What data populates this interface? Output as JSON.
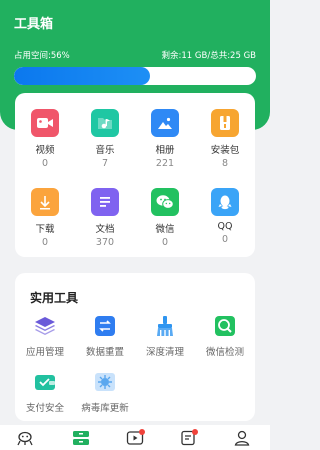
{
  "header": {
    "title": "工具箱",
    "storage_used": "占用空间:56%",
    "storage_total": "剩余:11 GB/总共:25 GB",
    "progress": 0.56,
    "accent": "#21b05f",
    "progress_color": "#0b78ee"
  },
  "files": [
    {
      "name": "视频",
      "count": "0",
      "icon": "video-icon",
      "color": "#f0566a"
    },
    {
      "name": "音乐",
      "count": "7",
      "icon": "music-icon",
      "color": "#1fc7a3"
    },
    {
      "name": "相册",
      "count": "221",
      "icon": "photo-icon",
      "color": "#2f89f5"
    },
    {
      "name": "安装包",
      "count": "8",
      "icon": "package-icon",
      "color": "#f7a531"
    },
    {
      "name": "下载",
      "count": "0",
      "icon": "download-icon",
      "color": "#fba43d"
    },
    {
      "name": "文档",
      "count": "370",
      "icon": "document-icon",
      "color": "#7f63f0"
    },
    {
      "name": "微信",
      "count": "0",
      "icon": "wechat-icon",
      "color": "#22c160"
    },
    {
      "name": "QQ",
      "count": "0",
      "icon": "qq-icon",
      "color": "#3aa4f7"
    }
  ],
  "tools": {
    "title": "实用工具",
    "items": [
      {
        "name": "应用管理",
        "icon": "layers-icon",
        "color": "#6a5ad9"
      },
      {
        "name": "数据重置",
        "icon": "sync-icon",
        "color": "#2f7df0"
      },
      {
        "name": "深度清理",
        "icon": "brush-icon",
        "color": "#2f95f0"
      },
      {
        "name": "微信检测",
        "icon": "wechat-scan-icon",
        "color": "#22c160"
      },
      {
        "name": "支付安全",
        "icon": "wallet-shield-icon",
        "color": "#22c1a0"
      },
      {
        "name": "病毒库更新",
        "icon": "virus-update-icon",
        "color": "#5aa7ef"
      }
    ]
  },
  "nav": [
    {
      "icon": "alien-icon",
      "active": false,
      "badge": false
    },
    {
      "icon": "toolbox-icon",
      "active": true,
      "badge": false
    },
    {
      "icon": "video-play-icon",
      "active": false,
      "badge": true
    },
    {
      "icon": "note-icon",
      "active": false,
      "badge": true
    },
    {
      "icon": "user-icon",
      "active": false,
      "badge": false
    }
  ]
}
